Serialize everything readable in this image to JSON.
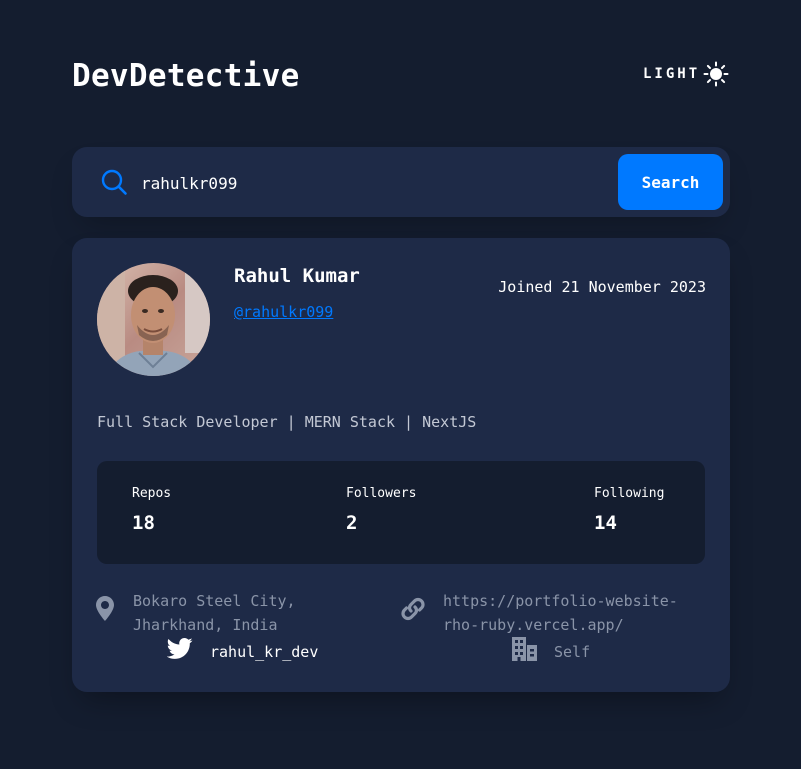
{
  "app": {
    "title": "DevDetective"
  },
  "theme_toggle": {
    "label": "LIGHT",
    "icon": "sun-icon"
  },
  "search": {
    "value": "rahulkr099",
    "placeholder": "",
    "button_label": "Search",
    "icon": "search-icon"
  },
  "profile": {
    "name": "Rahul Kumar",
    "handle": "@rahulkr099",
    "joined": "Joined 21 November 2023",
    "bio": "Full Stack Developer | MERN Stack | NextJS",
    "avatar": "avatar-photo"
  },
  "stats": [
    {
      "label": "Repos",
      "value": "18"
    },
    {
      "label": "Followers",
      "value": "2"
    },
    {
      "label": "Following",
      "value": "14"
    }
  ],
  "links": {
    "location": {
      "icon": "location-pin-icon",
      "line1": "Bokaro Steel City,",
      "line2": "Jharkhand, India"
    },
    "website": {
      "icon": "link-icon",
      "line1": "https://portfolio-website-",
      "line2": "rho-ruby.vercel.app/"
    },
    "twitter": {
      "icon": "twitter-icon",
      "text": "rahul_kr_dev"
    },
    "company": {
      "icon": "building-icon",
      "text": "Self"
    }
  },
  "colors": {
    "background": "#141d2f",
    "card": "#1e2a47",
    "accent": "#0079ff",
    "muted_text": "#8a94a8"
  }
}
